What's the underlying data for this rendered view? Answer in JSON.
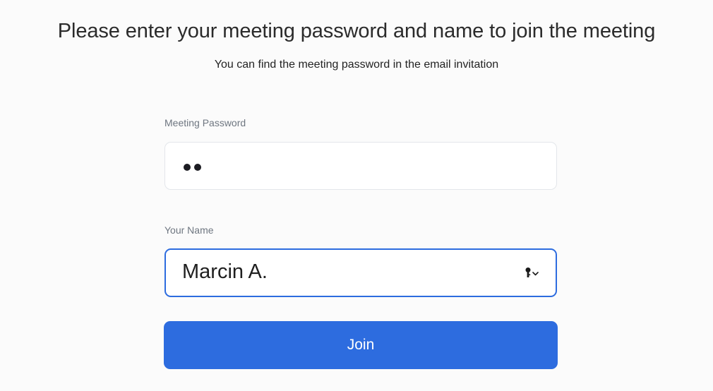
{
  "header": {
    "title": "Please enter your meeting password and name to join the meeting",
    "subtitle": "You can find the meeting password in the email invitation"
  },
  "password_field": {
    "label": "Meeting Password",
    "masked_length": 2
  },
  "name_field": {
    "label": "Your Name",
    "value": "Marcin A.",
    "accessory_icon": "key-autofill-dropdown-icon"
  },
  "join_button": {
    "label": "Join"
  },
  "colors": {
    "accent": "#2d6cdf",
    "background": "#fbfbfb",
    "input_border": "#e3e6ea",
    "label": "#6e7680"
  }
}
